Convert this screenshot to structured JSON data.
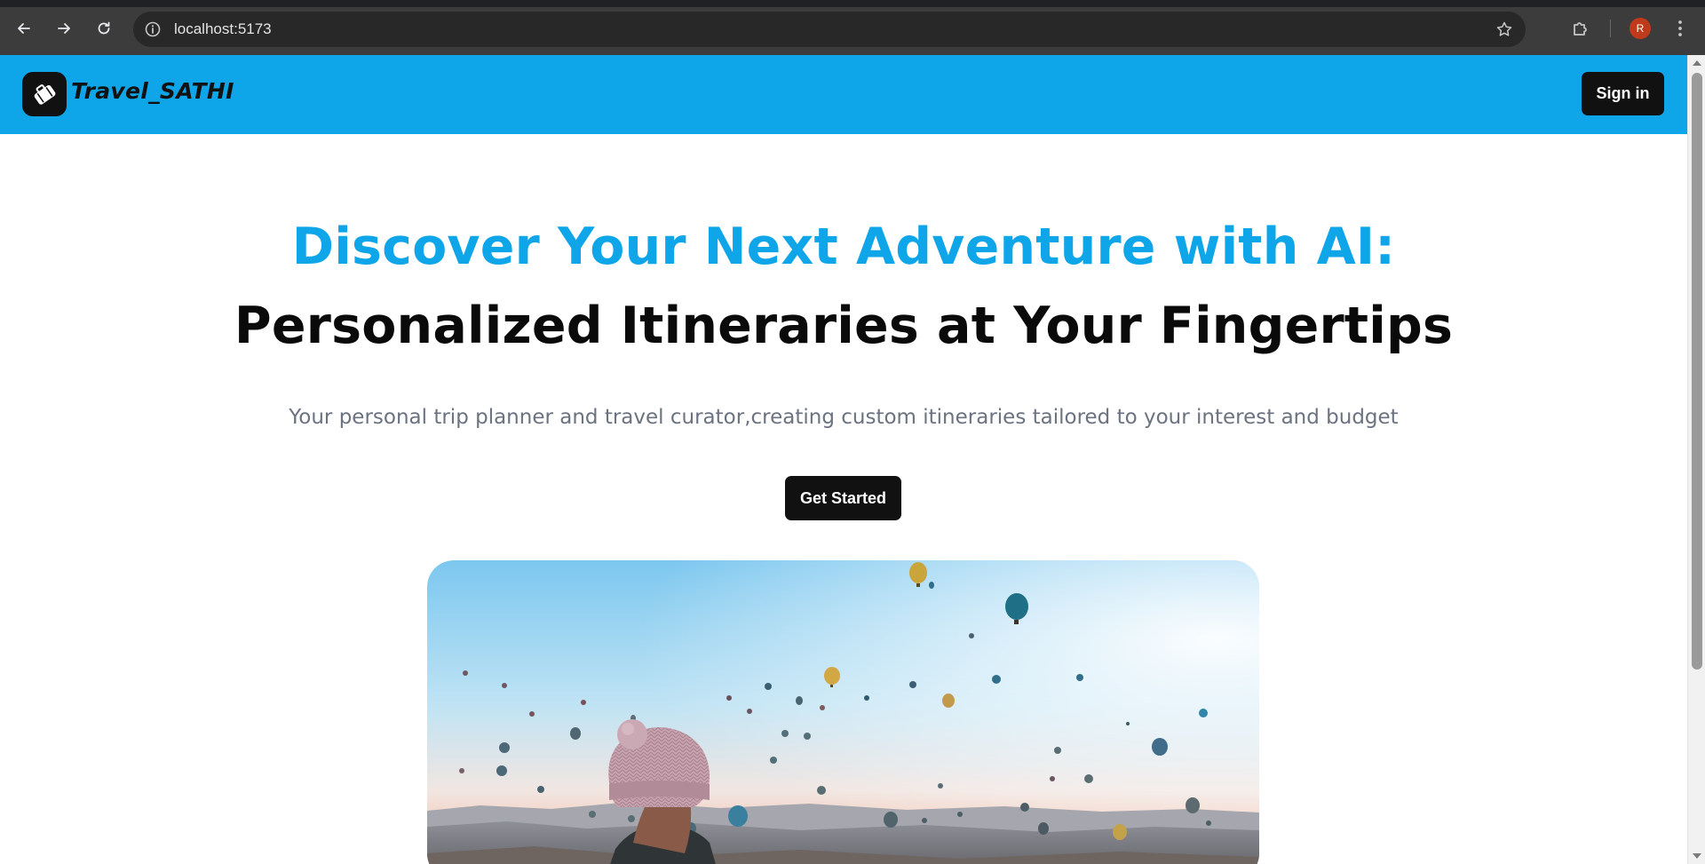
{
  "browser": {
    "url": "localhost:5173",
    "profile_initial": "R",
    "icons": {
      "back": "arrow-left-icon",
      "forward": "arrow-right-icon",
      "reload": "reload-icon",
      "site_info": "info-icon",
      "bookmark": "star-icon",
      "extensions": "puzzle-icon",
      "menu": "kebab-menu-icon"
    }
  },
  "header": {
    "brand": "Travel_SATHI",
    "logo_icon": "suitcase-icon",
    "signin_label": "Sign in"
  },
  "hero": {
    "title_line1": "Discover Your Next Adventure with AI:",
    "title_line2": "Personalized Itineraries at Your Fingertips",
    "subtitle": "Your personal trip planner and travel curator,creating custom itineraries tailored to your interest and budget",
    "cta_label": "Get Started",
    "image_subject": "person in knit beanie watching hot air balloons at sunrise"
  },
  "colors": {
    "header_bg": "#0ea5e9",
    "accent_text": "#0ea5e9",
    "button_bg": "#111111",
    "subtitle_text": "#6b7280"
  }
}
